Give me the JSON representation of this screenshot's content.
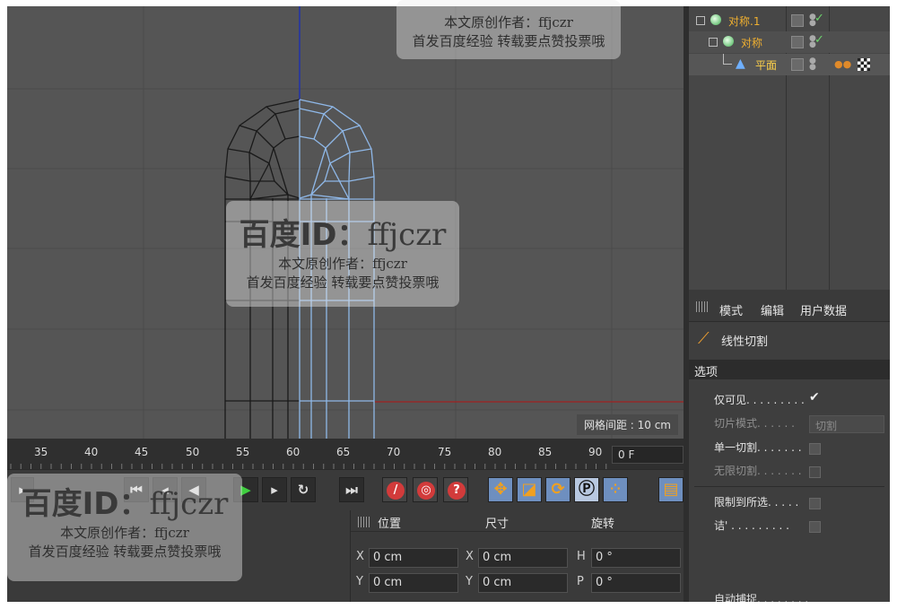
{
  "viewport": {
    "grid_spacing_label": "网格间距 : 10 cm"
  },
  "object_manager": {
    "objects": [
      {
        "name": "对称.1"
      },
      {
        "name": "对称"
      },
      {
        "name": "平面"
      }
    ]
  },
  "attributes": {
    "tabs": [
      "模式",
      "编辑",
      "用户数据"
    ],
    "tool_name": "线性切割",
    "section_title": "选项",
    "options": [
      {
        "label": "仅可见. . . . . . . . .",
        "checked": true
      },
      {
        "label": "切片模式. . . . . .",
        "value": "切割",
        "dimmed": true
      },
      {
        "label": "单一切割. . . . . . .",
        "checked": false
      },
      {
        "label": "无限切割. . . . . . .",
        "checked": false,
        "dimmed": true
      },
      {
        "label": "限制到所选. . . . .",
        "checked": false
      },
      {
        "label": "诘' . . . . . . . . .",
        "checked": false
      },
      {
        "label": "自动捕捉. . . . . . . .",
        "checked": true
      }
    ]
  },
  "timeline": {
    "ticks": [
      "35",
      "40",
      "45",
      "50",
      "55",
      "60",
      "65",
      "70",
      "75",
      "80",
      "85",
      "90"
    ],
    "current_frame": "0 F"
  },
  "coordinates": {
    "headers": [
      "位置",
      "尺寸",
      "旋转"
    ],
    "rows": [
      {
        "pos_axis": "X",
        "pos": "0 cm",
        "size_axis": "X",
        "size": "0 cm",
        "rot_axis": "H",
        "rot": "0 °"
      },
      {
        "pos_axis": "Y",
        "pos": "0 cm",
        "size_axis": "Y",
        "size": "0 cm",
        "rot_axis": "P",
        "rot": "0 °"
      }
    ]
  },
  "watermarks": [
    {
      "id_label": "百度ID：",
      "id_value": "ffjczr",
      "author": "本文原创作者：ffjczr",
      "note": "首发百度经验 转载要点赞投票哦"
    }
  ],
  "colors": {
    "viewport_bg": "#555555",
    "mesh_black": "#1a1a1a",
    "mesh_blue": "#8fb8e8",
    "object_label": "#f0b030",
    "record_red": "#d23b3b",
    "play_green": "#3fcf3f"
  }
}
